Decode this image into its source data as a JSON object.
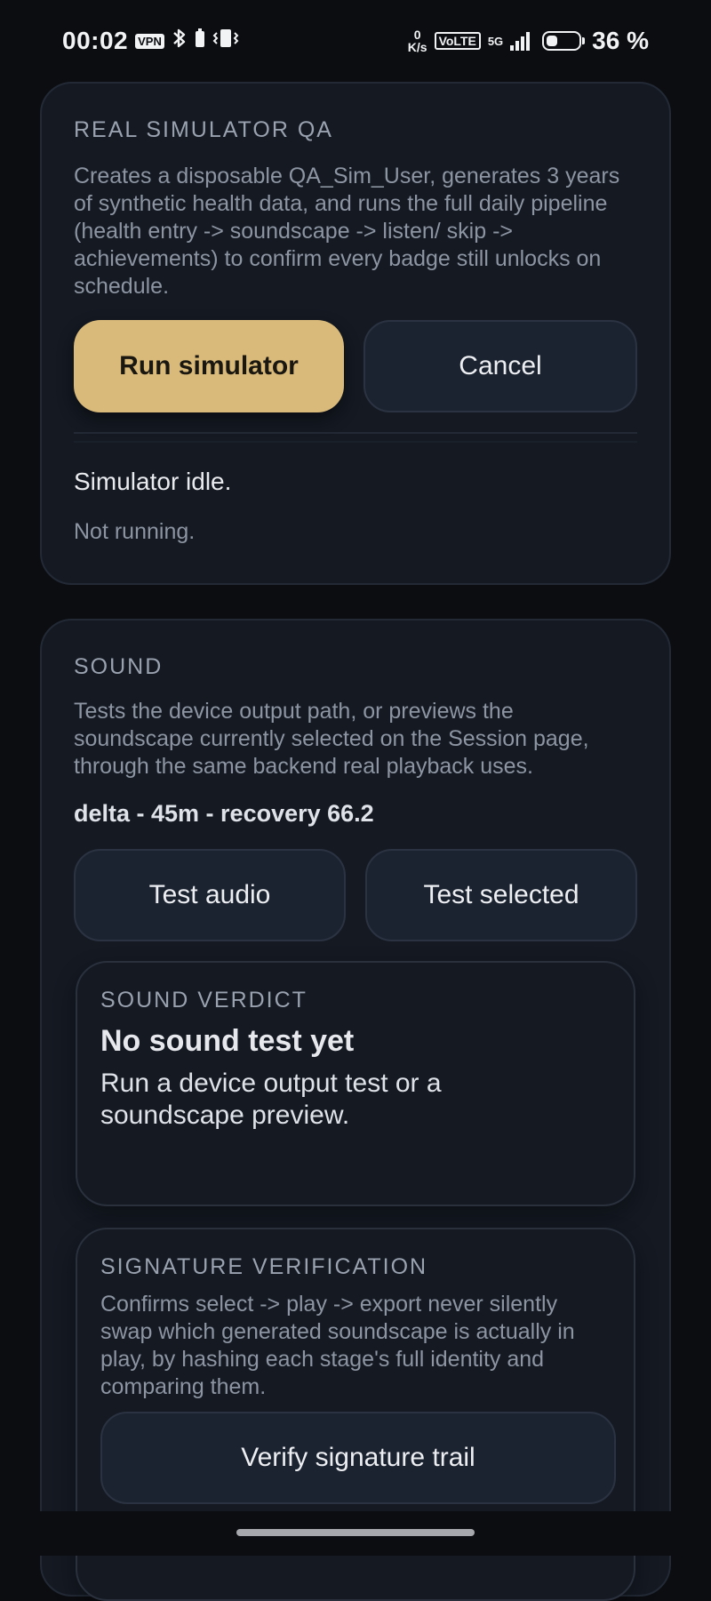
{
  "status_bar": {
    "time": "00:02",
    "vpn": "VPN",
    "speed_value": "0",
    "speed_unit": "K/s",
    "volte": "VoLTE",
    "network": "5G",
    "battery_percent": "36 %",
    "battery_level": 0.36
  },
  "simulator": {
    "title": "REAL SIMULATOR QA",
    "description": "Creates a disposable QA_Sim_User, generates 3 years of synthetic health data, and runs the full daily pipeline (health entry -> soundscape -> listen/ skip -> achievements) to confirm every badge still unlocks on schedule.",
    "run_label": "Run simulator",
    "cancel_label": "Cancel",
    "status": "Simulator idle.",
    "substatus": "Not running."
  },
  "sound": {
    "title": "SOUND",
    "description": "Tests the device output path, or previews the soundscape currently selected on the Session page, through the same backend real playback uses.",
    "selected": "delta - 45m - recovery 66.2",
    "test_audio_label": "Test audio",
    "test_selected_label": "Test selected",
    "verdict": {
      "eyebrow": "SOUND VERDICT",
      "title": "No sound test yet",
      "body": "Run a device output test or a soundscape preview."
    },
    "signature": {
      "eyebrow": "SIGNATURE VERIFICATION",
      "description": "Confirms select -> play -> export never silently swap which generated soundscape is actually in play, by hashing each stage's full identity and comparing them.",
      "verify_label": "Verify signature trail"
    }
  },
  "icons": {
    "bluetooth": "bluetooth-icon",
    "vibrate": "vibrate-icon",
    "signal": "signal-bars-icon",
    "battery": "battery-icon"
  },
  "colors": {
    "background": "#0b0d11",
    "card": "#141922",
    "accent": "#d9ba7a",
    "muted_text": "#8d95a3"
  }
}
